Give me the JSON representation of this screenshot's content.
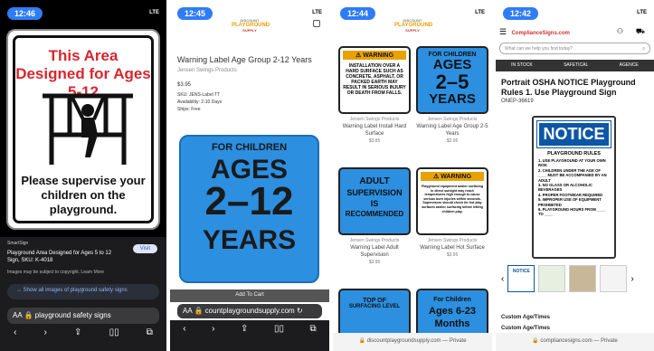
{
  "panel1": {
    "time": "12:46",
    "status": "LTE",
    "sign_title": "This Area Designed for Ages 5-12",
    "sign_message": "Please supervise your children on the playground.",
    "source": "SmartSign",
    "title": "Playground Area Designed for Ages 5 to 12 Sign, SKU: K-4018",
    "visit": "Visit",
    "copyright": "Images may be subject to copyright. Learn More",
    "show_all": "Show all images of playground safety signs",
    "aa": "AA",
    "address": "playground safety signs"
  },
  "panel2": {
    "time": "12:45",
    "status": "LTE",
    "logo_top": "DISCOUNT",
    "logo_main": "PLAYGROUND",
    "logo_bottom": "SUPPLY",
    "product": "Warning Label Age Group 2-12 Years",
    "vendor": "Jensen Swings Products",
    "price": "$3.95",
    "sku": "SKU: JENS-Label TT",
    "availability": "Availability: 2-10 Days",
    "ships": "Ships: Free",
    "sign_line1": "FOR CHILDREN",
    "sign_line2": "AGES",
    "sign_line3": "2–12",
    "sign_line4": "YEARS",
    "add_to_cart": "Add To Cart",
    "aa": "AA",
    "address": "countplaygroundsupply.com"
  },
  "panel3": {
    "time": "12:44",
    "status": "LTE",
    "logo_top": "DISCOUNT",
    "logo_main": "PLAYGROUND",
    "logo_bottom": "SUPPLY",
    "tile1": {
      "warn": "WARNING",
      "text": "INSTALLATION OVER A HARD SURFACE SUCH AS CONCRETE, ASPHALT, OR PACKED EARTH MAY RESULT IN SERIOUS INJURY OR DEATH FROM FALLS.",
      "vendor": "Jensen Swings Products",
      "name": "Warning Label Install Hard Surface",
      "price": "$3.95"
    },
    "tile2": {
      "l1": "FOR CHILDREN",
      "l2": "AGES",
      "l3": "2–5",
      "l4": "YEARS",
      "vendor": "Jensen Swings Products",
      "name": "Warning Label Age Group 2-5 Years",
      "price": "$3.95"
    },
    "tile3": {
      "l1": "ADULT",
      "l2": "SUPERVISION",
      "l3": "IS",
      "l4": "RECOMMENDED",
      "vendor": "Jensen Swings Products",
      "name": "Warning Label Adult Supervision",
      "price": "$3.95"
    },
    "tile4": {
      "warn": "WARNING",
      "text": "Playground equipment and/or surfacing in direct sunlight may reach temperatures high enough to cause serious burn injuries within seconds. Supervisors should check for hot play surfaces and/or surfacing before letting children play.",
      "vendor": "Jensen Swings Products",
      "name": "Warning Label Hot Surface",
      "price": "$3.95"
    },
    "tile5": {
      "l1": "TOP OF",
      "l2": "SURFACING LEVEL"
    },
    "tile6": {
      "l1": "For Children",
      "l2": "Ages 6-23",
      "l3": "Months"
    },
    "footer": "discountplaygroundsupply.com — Private"
  },
  "panel4": {
    "time": "12:42",
    "status": "LTE",
    "brand": "ComplianceSigns.com",
    "search_placeholder": "What can we help you find today?",
    "strip1": "IN STOCK",
    "strip2": "SAFETICAL",
    "strip3": "AGENCE",
    "title": "Portrait OSHA NOTICE Playground Rules 1. Use Playground Sign",
    "sku": "ONEP-36619",
    "notice_head": "NOTICE",
    "notice_sub": "PLAYGROUND RULES",
    "rules": [
      "1. USE PLAYGROUND AT YOUR OWN RISK",
      "2. CHILDREN UNDER THE AGE OF ____ MUST BE ACCOMPANIED BY AN ADULT",
      "3. NO GLASS OR ALCOHOLIC BEVERAGES",
      "4. PROPER FOOTWEAR REQUIRED",
      "5. IMPROPER USE OF EQUIPMENT PROHIBITED",
      "6. PLAYGROUND HOURS FROM ____ TO ____"
    ],
    "thumb_label": "NOTICE",
    "custom1": "Custom Age/Times",
    "custom2": "Custom Age/Times",
    "footer": "compliancesigns.com — Private"
  }
}
